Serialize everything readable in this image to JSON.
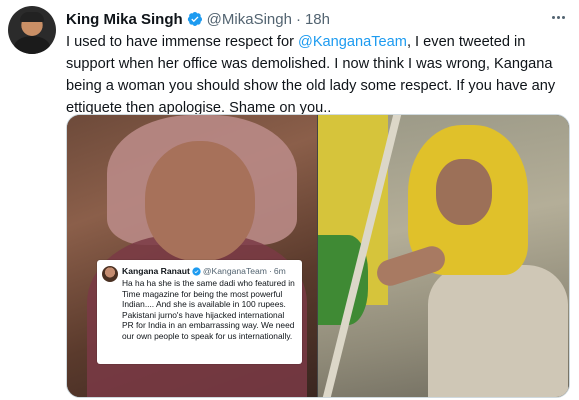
{
  "tweet": {
    "author_name": "King Mika Singh",
    "handle": "@MikaSingh",
    "separator": "·",
    "time": "18h",
    "text_before_mention": "I used to have immense respect for ",
    "mention": "@KanganaTeam",
    "text_after_mention": ", I even tweeted in support when her office was demolished. I now think I was wrong, Kangana being a woman you should show the old lady some respect. If you have any ettiquete then apologise. Shame on you..",
    "more_icon": "more-horizontal-icon",
    "verified_icon": "verified-badge-icon"
  },
  "embedded_tweet": {
    "author_name": "Kangana Ranaut",
    "handle": "@KanganaTeam",
    "separator": "·",
    "time": "6m",
    "text": "Ha ha ha she is the same dadi who featured in Time magazine for being the most powerful Indian.... And she is available in 100 rupees. Pakistani jurno's have hijacked international PR for India in an embarrassing way. We need our own people to speak for us internationally."
  },
  "colors": {
    "link": "#1d9bf0",
    "verified": "#1d9bf0",
    "secondary_text": "#536471"
  }
}
